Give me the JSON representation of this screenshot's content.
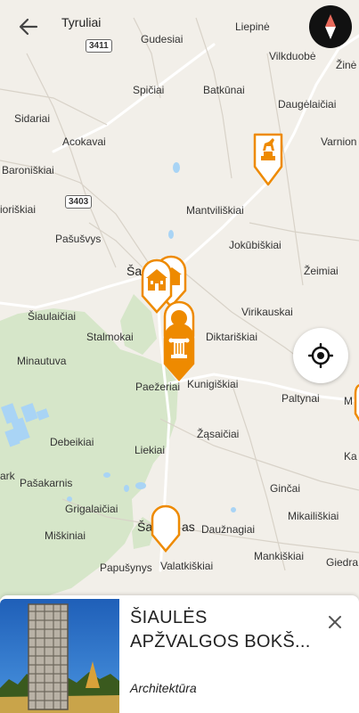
{
  "map": {
    "places": [
      {
        "id": "tyruliai",
        "name": "Tyruliai"
      },
      {
        "id": "liepine",
        "name": "Liepinė"
      },
      {
        "id": "gudesiai",
        "name": "Gudesiai"
      },
      {
        "id": "vilkduobe",
        "name": "Vilkduobė"
      },
      {
        "id": "zine",
        "name": "Žinė"
      },
      {
        "id": "spiciai",
        "name": "Spičiai"
      },
      {
        "id": "batkunai",
        "name": "Batkūnai"
      },
      {
        "id": "daugelaiciai",
        "name": "Daugėlaičiai"
      },
      {
        "id": "sidariai",
        "name": "Sidariai"
      },
      {
        "id": "acokavai",
        "name": "Acokavai"
      },
      {
        "id": "varnion",
        "name": "Varnion"
      },
      {
        "id": "baroniskiai",
        "name": "Baroniškiai"
      },
      {
        "id": "ioriskiai",
        "name": "ioriškiai"
      },
      {
        "id": "mantviliskiai",
        "name": "Mantviliškiai"
      },
      {
        "id": "pasusvys",
        "name": "Pašušvys"
      },
      {
        "id": "jokubiskiai",
        "name": "Jokūbiškiai"
      },
      {
        "id": "zeimiai",
        "name": "Žeimiai"
      },
      {
        "id": "siaul_north",
        "name": "Ša"
      },
      {
        "id": "siaulaiciai",
        "name": "Šiaulaičiai"
      },
      {
        "id": "stalmokai",
        "name": "Stalmokai"
      },
      {
        "id": "virikauskai",
        "name": "Virikauskai"
      },
      {
        "id": "minautuva",
        "name": "Minautuva"
      },
      {
        "id": "diktariskiai",
        "name": "Diktariškiai"
      },
      {
        "id": "paezeriai",
        "name": "Paežeriai"
      },
      {
        "id": "kunigiskiai",
        "name": "Kunigiškiai"
      },
      {
        "id": "paltynai",
        "name": "Paltynai"
      },
      {
        "id": "m_edge",
        "name": "M"
      },
      {
        "id": "zasaiciai",
        "name": "Žąsaičiai"
      },
      {
        "id": "debeikiai",
        "name": "Debeikiai"
      },
      {
        "id": "liekiai",
        "name": "Liekiai"
      },
      {
        "id": "ka",
        "name": "Ka"
      },
      {
        "id": "ark",
        "name": "ark"
      },
      {
        "id": "pasakarnis",
        "name": "Pašakarnis"
      },
      {
        "id": "gincai",
        "name": "Ginčai"
      },
      {
        "id": "grigalaiciai",
        "name": "Grigalaičiai"
      },
      {
        "id": "mikailiskiai",
        "name": "Mikailiškiai"
      },
      {
        "id": "siaul_south",
        "name": "Ša"
      },
      {
        "id": "as",
        "name": "as"
      },
      {
        "id": "dauznagiai",
        "name": "Daužnagiai"
      },
      {
        "id": "miskiniai",
        "name": "Miškiniai"
      },
      {
        "id": "mankiskiai",
        "name": "Mankiškiai"
      },
      {
        "id": "papusynys",
        "name": "Papušynys"
      },
      {
        "id": "valatkiskiai",
        "name": "Valatkiškiai"
      },
      {
        "id": "giedra",
        "name": "Giedra"
      }
    ],
    "routes": [
      {
        "id": "r3411",
        "number": "3411"
      },
      {
        "id": "r3403",
        "number": "3403"
      }
    ],
    "pins": [
      {
        "id": "pin-monument",
        "icon": "horse-statue-icon"
      },
      {
        "id": "pin-estate-back",
        "icon": "building-icon"
      },
      {
        "id": "pin-estate",
        "icon": "manor-house-icon"
      },
      {
        "id": "pin-nature",
        "icon": "tree-icon"
      },
      {
        "id": "pin-architecture",
        "icon": "column-icon"
      },
      {
        "id": "pin-selected",
        "icon": "empty-pin-icon"
      }
    ],
    "accent_color": "#ee8a00",
    "forest_color": "#d4e6c8",
    "water_color": "#a9d4f5"
  },
  "controls": {
    "back_icon": "arrow-left-icon",
    "compass_icon": "compass-icon",
    "locate_icon": "crosshair-icon"
  },
  "card": {
    "title": "ŠIAULĖS APŽVALGOS BOKŠ...",
    "category": "Architektūra",
    "close_icon": "close-icon"
  }
}
